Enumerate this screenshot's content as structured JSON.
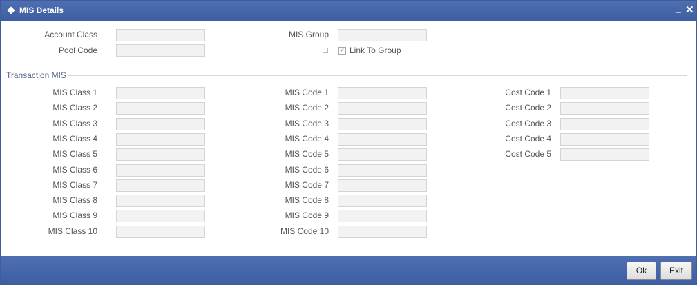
{
  "window": {
    "title": "MIS Details",
    "minimize": "_",
    "close": "✕"
  },
  "top": {
    "account_class_label": "Account Class",
    "pool_code_label": "Pool Code",
    "mis_group_label": "MIS Group",
    "link_to_group_label": "Link To Group",
    "link_to_group_checked": true
  },
  "section_title": "Transaction MIS",
  "mis_class_labels": [
    "MIS Class 1",
    "MIS Class 2",
    "MIS Class 3",
    "MIS Class 4",
    "MIS Class 5",
    "MIS Class 6",
    "MIS Class 7",
    "MIS Class 8",
    "MIS Class 9",
    "MIS Class 10"
  ],
  "mis_code_labels": [
    "MIS Code 1",
    "MIS Code 2",
    "MIS Code 3",
    "MIS Code 4",
    "MIS Code 5",
    "MIS Code 6",
    "MIS Code 7",
    "MIS Code 8",
    "MIS Code 9",
    "MIS Code 10"
  ],
  "cost_code_labels": [
    "Cost Code 1",
    "Cost Code 2",
    "Cost Code 3",
    "Cost Code 4",
    "Cost Code 5"
  ],
  "footer": {
    "ok_label": "Ok",
    "exit_label": "Exit"
  },
  "colors": {
    "titlebar": "#4566aa",
    "footer": "#4566aa",
    "field_bg": "#f2f2f2"
  }
}
